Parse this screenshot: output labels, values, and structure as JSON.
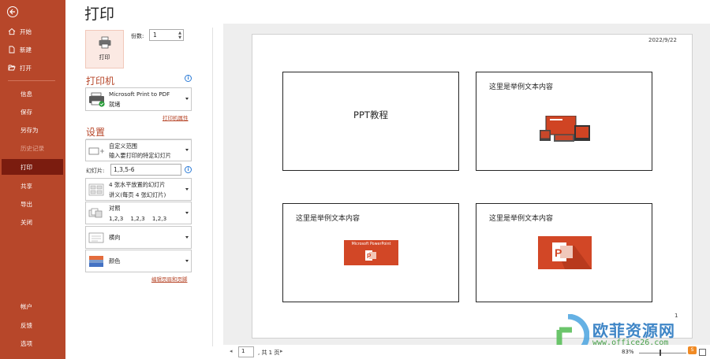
{
  "page_title": "打印",
  "sidebar": {
    "back_icon": "arrow-left-circle-icon",
    "items": [
      {
        "label": "开始",
        "icon": "home-icon"
      },
      {
        "label": "新建",
        "icon": "new-document-icon"
      },
      {
        "label": "打开",
        "icon": "folder-open-icon"
      },
      {
        "label": "信息"
      },
      {
        "label": "保存"
      },
      {
        "label": "另存为"
      },
      {
        "label": "历史记录"
      },
      {
        "label": "打印"
      },
      {
        "label": "共享"
      },
      {
        "label": "导出"
      },
      {
        "label": "关闭"
      },
      {
        "label": "帐户"
      },
      {
        "label": "反馈"
      },
      {
        "label": "选项"
      }
    ],
    "active_item": "打印",
    "disabled_item": "历史记录"
  },
  "print": {
    "button_label": "打印",
    "copies_label": "份数:",
    "copies_value": "1"
  },
  "printer": {
    "section_title": "打印机",
    "name": "Microsoft Print to PDF",
    "status": "就绪",
    "properties_link": "打印机属性"
  },
  "settings": {
    "section_title": "设置",
    "range": {
      "title": "自定义范围",
      "subtitle": "输入要打印的特定幻灯片"
    },
    "slides_label": "幻灯片:",
    "slides_value": "1,3,5-6",
    "layout": {
      "title": "4 张水平放置的幻灯片",
      "subtitle": "讲义(每页 4 张幻灯片)"
    },
    "collate": {
      "title": "对照",
      "subtitle": "1,2,3    1,2,3    1,2,3"
    },
    "orientation": {
      "title": "横向"
    },
    "color": {
      "title": "颜色"
    },
    "header_footer_link": "编辑页眉和页脚"
  },
  "preview": {
    "date": "2022/9/22",
    "page_number": "1",
    "slides": [
      {
        "title": "PPT教程",
        "centered": true
      },
      {
        "title": "这里是举例文本内容",
        "image": "powerpoint-devices-icon"
      },
      {
        "title": "这里是举例文本内容",
        "image": "microsoft-powerpoint-banner",
        "banner_text": "Microsoft PowerPoint"
      },
      {
        "title": "这里是举例文本内容",
        "image": "powerpoint-logo-icon"
      }
    ]
  },
  "pager": {
    "current": "1",
    "total_text": ", 共 1 页"
  },
  "zoom": {
    "level": "83%"
  },
  "watermark": {
    "text": "欧菲资源网",
    "url": "www.office26.com"
  },
  "colors": {
    "accent": "#b7472a",
    "active_nav": "#7b1c0f",
    "link": "#b7472a",
    "info": "#2b7bd6"
  }
}
